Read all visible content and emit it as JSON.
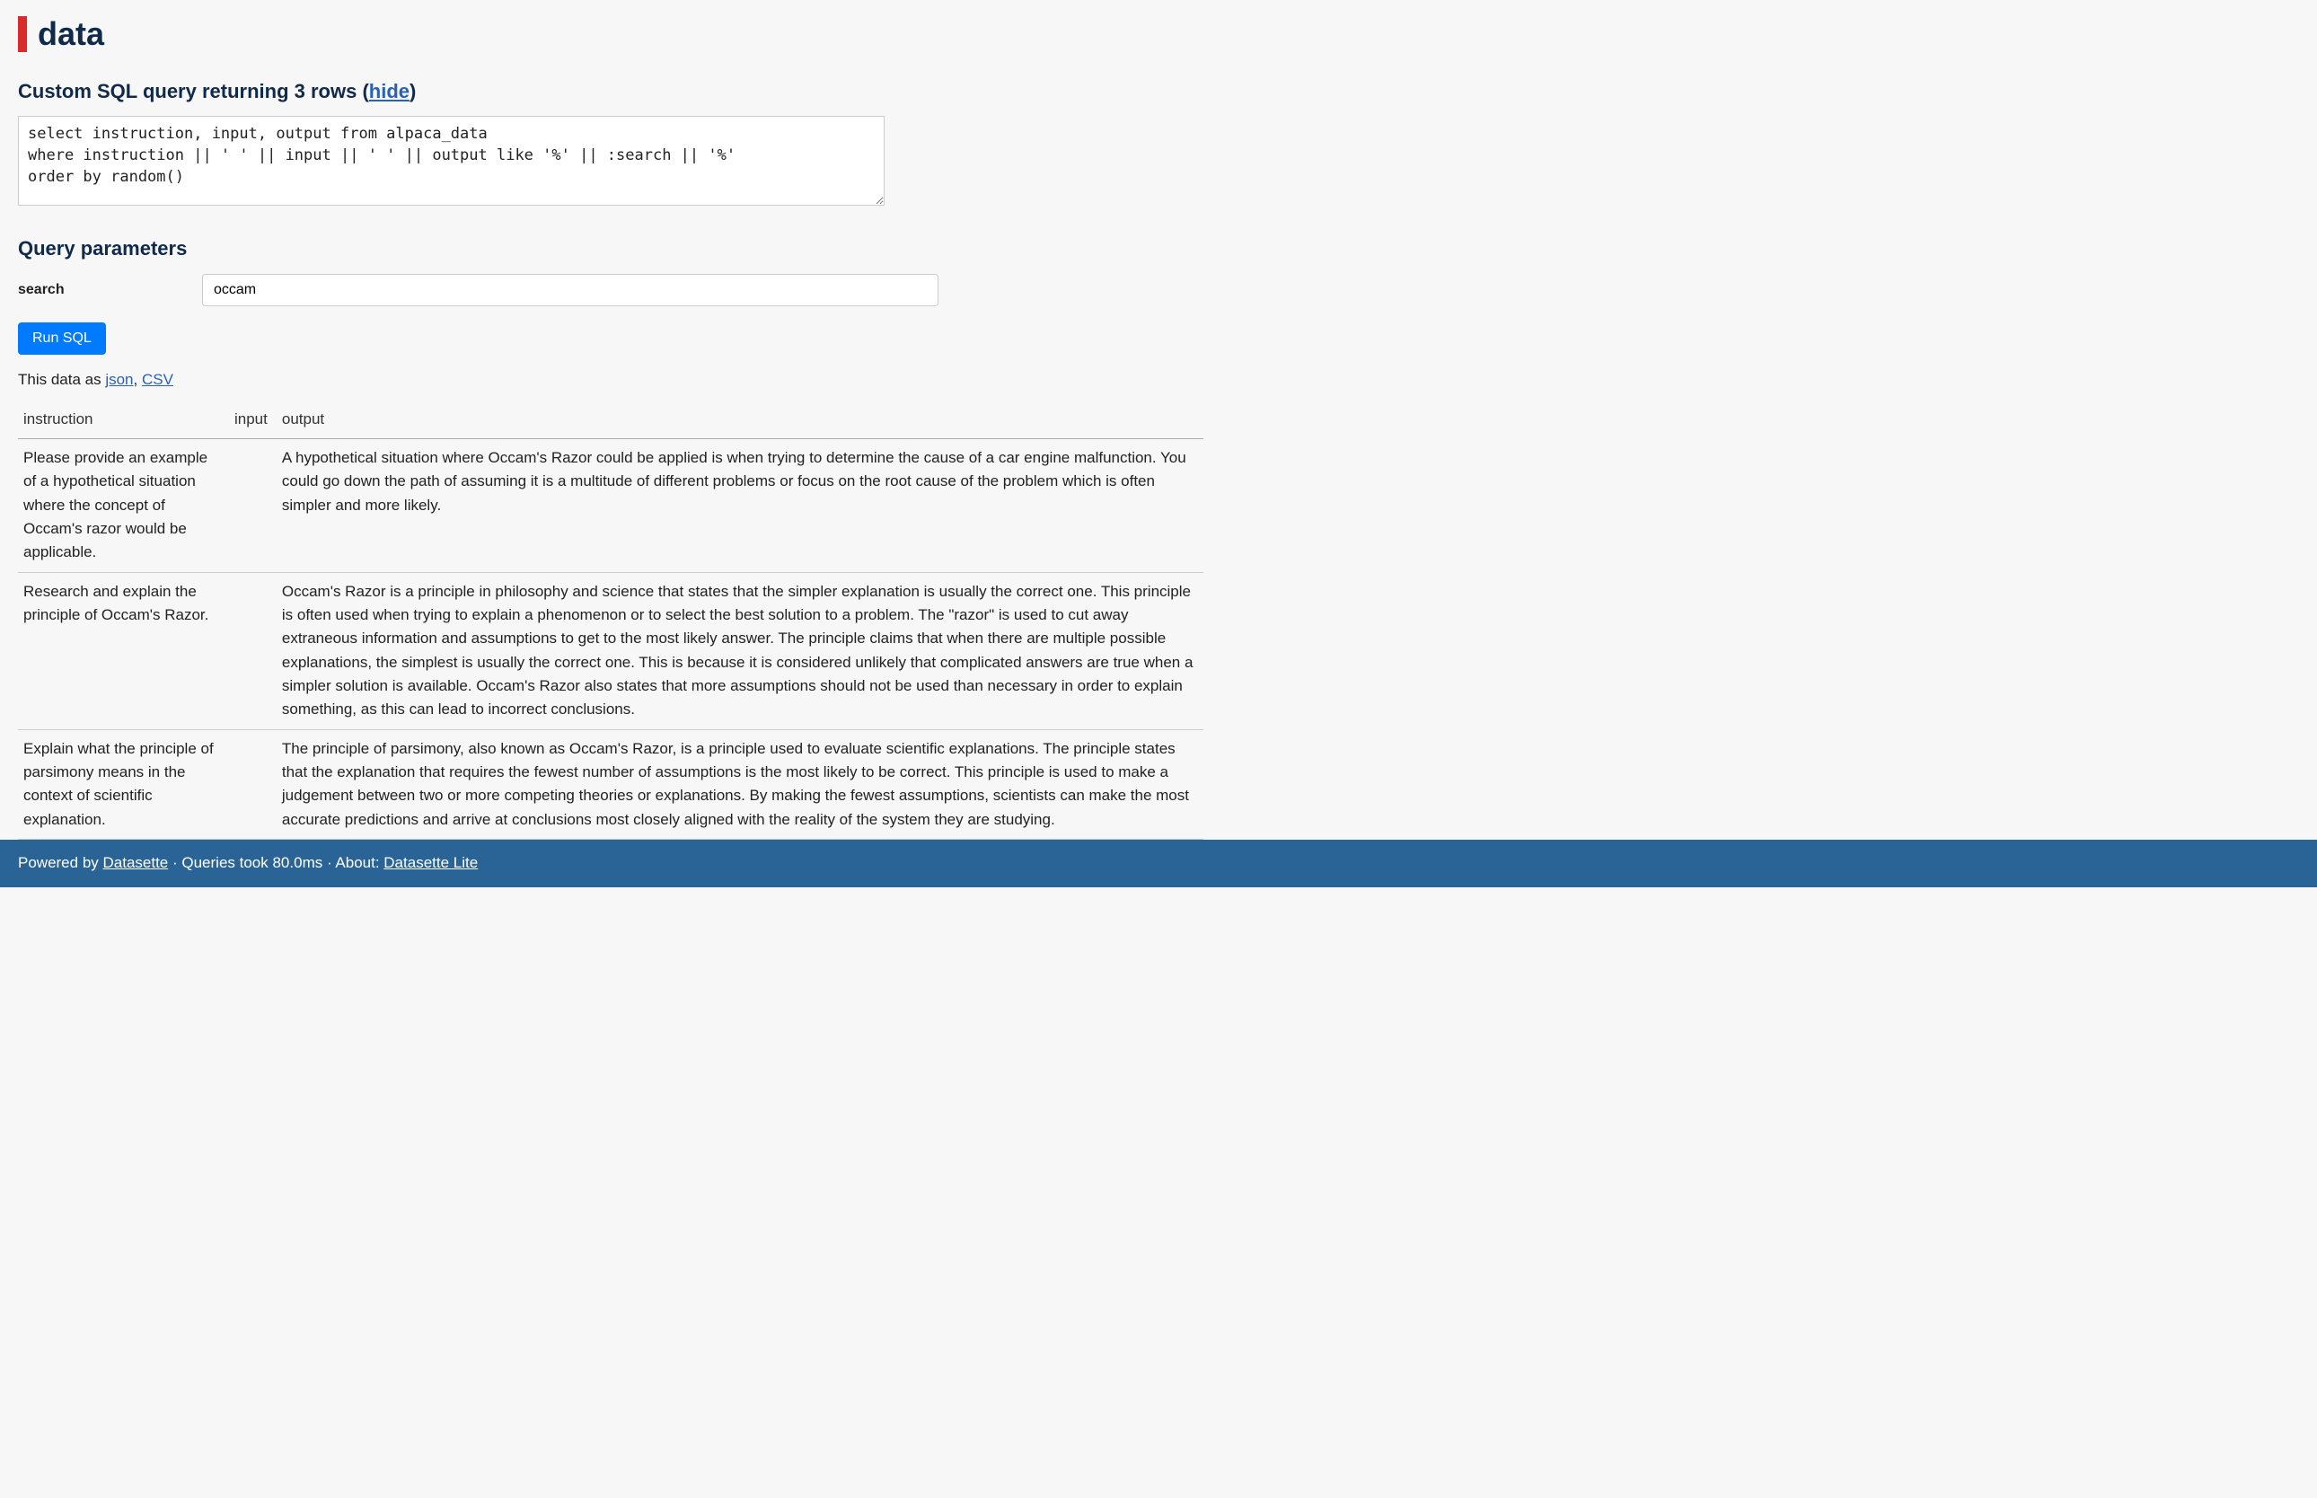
{
  "page": {
    "title": "data"
  },
  "query": {
    "heading_prefix": "Custom SQL query returning ",
    "row_count": "3 rows",
    "heading_open_paren": " (",
    "hide_label": "hide",
    "heading_close_paren": ")",
    "sql": "select instruction, input, output from alpaca_data\nwhere instruction || ' ' || input || ' ' || output like '%' || :search || '%'\norder by random()"
  },
  "params": {
    "heading": "Query parameters",
    "items": [
      {
        "label": "search",
        "value": "occam"
      }
    ]
  },
  "run_button": "Run SQL",
  "export": {
    "prefix": "This data as ",
    "json_label": "json",
    "separator": ", ",
    "csv_label": "CSV"
  },
  "table": {
    "columns": [
      "instruction",
      "input",
      "output"
    ],
    "rows": [
      {
        "instruction": "Please provide an example of a hypothetical situation where the concept of Occam's razor would be applicable.",
        "input": "",
        "output": "A hypothetical situation where Occam's Razor could be applied is when trying to determine the cause of a car engine malfunction. You could go down the path of assuming it is a multitude of different problems or focus on the root cause of the problem which is often simpler and more likely."
      },
      {
        "instruction": "Research and explain the principle of Occam's Razor.",
        "input": "",
        "output": "Occam's Razor is a principle in philosophy and science that states that the simpler explanation is usually the correct one. This principle is often used when trying to explain a phenomenon or to select the best solution to a problem. The \"razor\" is used to cut away extraneous information and assumptions to get to the most likely answer. The principle claims that when there are multiple possible explanations, the simplest is usually the correct one. This is because it is considered unlikely that complicated answers are true when a simpler solution is available. Occam's Razor also states that more assumptions should not be used than necessary in order to explain something, as this can lead to incorrect conclusions."
      },
      {
        "instruction": "Explain what the principle of parsimony means in the context of scientific explanation.",
        "input": "",
        "output": "The principle of parsimony, also known as Occam's Razor, is a principle used to evaluate scientific explanations. The principle states that the explanation that requires the fewest number of assumptions is the most likely to be correct. This principle is used to make a judgement between two or more competing theories or explanations. By making the fewest assumptions, scientists can make the most accurate predictions and arrive at conclusions most closely aligned with the reality of the system they are studying."
      }
    ]
  },
  "footer": {
    "powered_prefix": "Powered by ",
    "datasette_label": "Datasette",
    "timing_sep": " · ",
    "timing_text": "Queries took 80.0ms",
    "about_sep": " · About: ",
    "about_label": "Datasette Lite"
  }
}
